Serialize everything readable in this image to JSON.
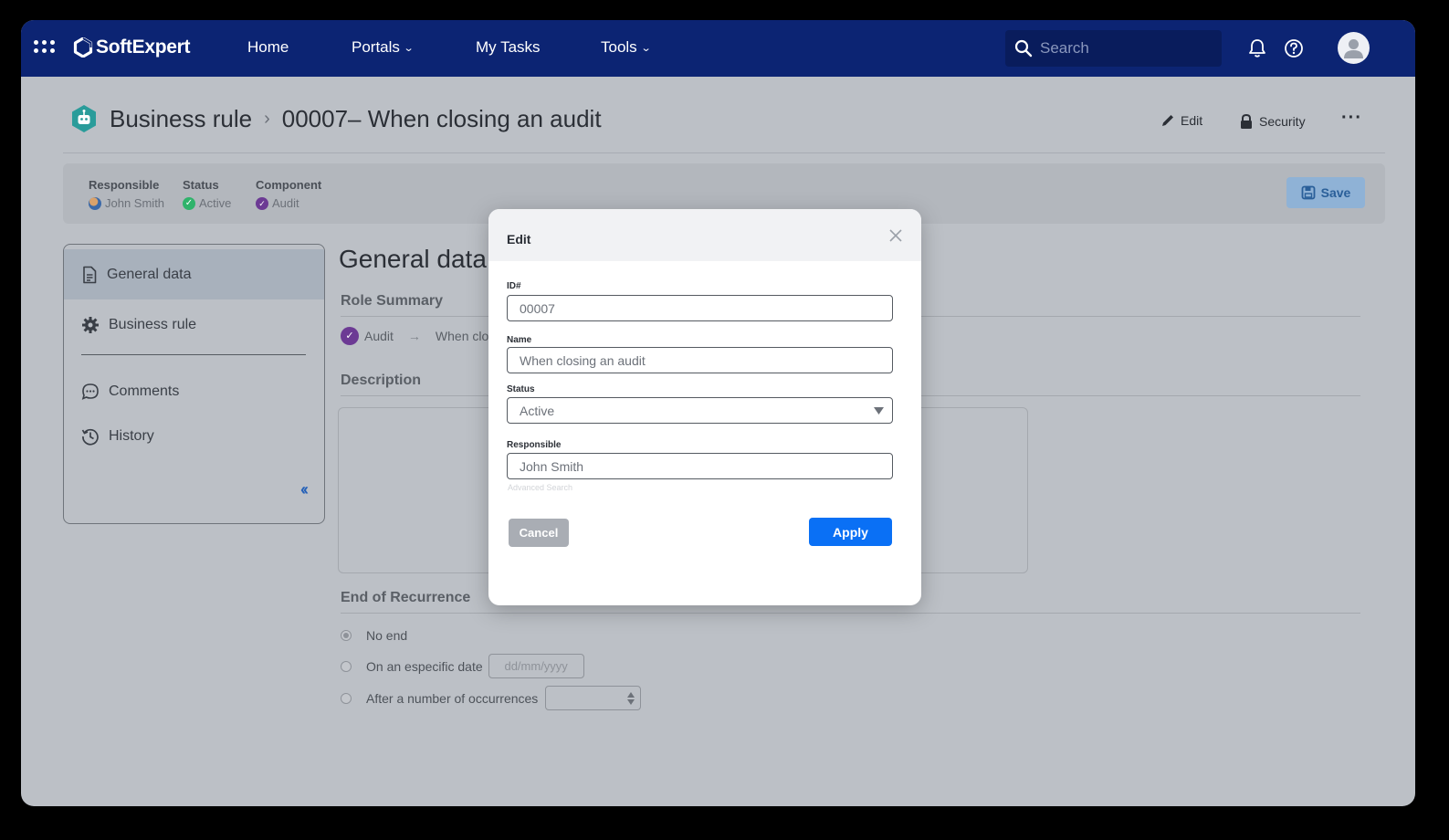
{
  "app": {
    "brand": "SoftExpert"
  },
  "nav": {
    "home": "Home",
    "portals": "Portals",
    "my_tasks": "My Tasks",
    "tools": "Tools"
  },
  "search": {
    "placeholder": "Search"
  },
  "breadcrumb": {
    "section": "Business rule",
    "record": "00007– When closing an audit"
  },
  "actions": {
    "edit": "Edit",
    "security": "Security",
    "save": "Save"
  },
  "info": {
    "responsible_label": "Responsible",
    "responsible_value": "John Smith",
    "status_label": "Status",
    "status_value": "Active",
    "component_label": "Component",
    "component_value": "Audit"
  },
  "sidebar": {
    "items": [
      {
        "label": "General data",
        "icon": "document-icon"
      },
      {
        "label": "Business rule",
        "icon": "gear-icon"
      },
      {
        "label": "Comments",
        "icon": "comment-icon"
      },
      {
        "label": "History",
        "icon": "history-icon"
      }
    ]
  },
  "main": {
    "title": "General data",
    "role_summary": "Role Summary",
    "summary_component": "Audit",
    "summary_rule": "When closin",
    "description": "Description",
    "end_of_recurrence": "End of Recurrence",
    "options": {
      "no_end": "No end",
      "specific_date": "On an especific date",
      "date_placeholder": "dd/mm/yyyy",
      "occurrences": "After a number of occurrences"
    }
  },
  "modal": {
    "title": "Edit",
    "id_label": "ID#",
    "id_value": "00007",
    "name_label": "Name",
    "name_value": "When closing an audit",
    "status_label": "Status",
    "status_value": "Active",
    "responsible_label": "Responsible",
    "responsible_value": "John Smith",
    "advanced_search": "Advanced Search",
    "cancel": "Cancel",
    "apply": "Apply"
  },
  "colors": {
    "topbar": "#0c2473",
    "accent": "#0a70f5",
    "active_status": "#2fb36b",
    "audit": "#6c3a94"
  }
}
